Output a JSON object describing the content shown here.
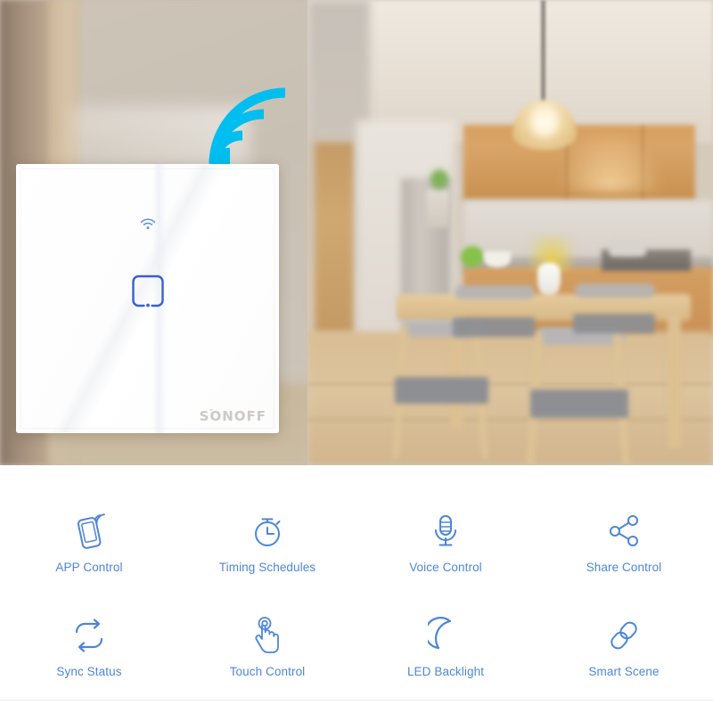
{
  "colors": {
    "accent_blue": "#4d86d6",
    "wifi_cyan": "#00bff0",
    "touch_button_blue": "#3b5fd0",
    "logo_gray": "#cdc9c4",
    "panel_white": "#ffffff"
  },
  "hero": {
    "wifi_broadcast_icon": "wifi-broadcast-icon",
    "scene_description": "blurred modern kitchen with dining table"
  },
  "switch_panel": {
    "wifi_indicator_icon": "wifi-indicator-icon",
    "touch_button_icon": "touch-button-square-icon",
    "brand": "SONOFF"
  },
  "features": [
    {
      "label": "APP Control",
      "icon": "phone-signal-icon"
    },
    {
      "label": "Timing Schedules",
      "icon": "stopwatch-icon"
    },
    {
      "label": "Voice Control",
      "icon": "microphone-icon"
    },
    {
      "label": "Share Control",
      "icon": "share-nodes-icon"
    },
    {
      "label": "Sync Status",
      "icon": "sync-arrows-icon"
    },
    {
      "label": "Touch Control",
      "icon": "touch-hand-icon"
    },
    {
      "label": "LED Backlight",
      "icon": "crescent-moon-icon"
    },
    {
      "label": "Smart Scene",
      "icon": "chain-link-icon"
    }
  ]
}
